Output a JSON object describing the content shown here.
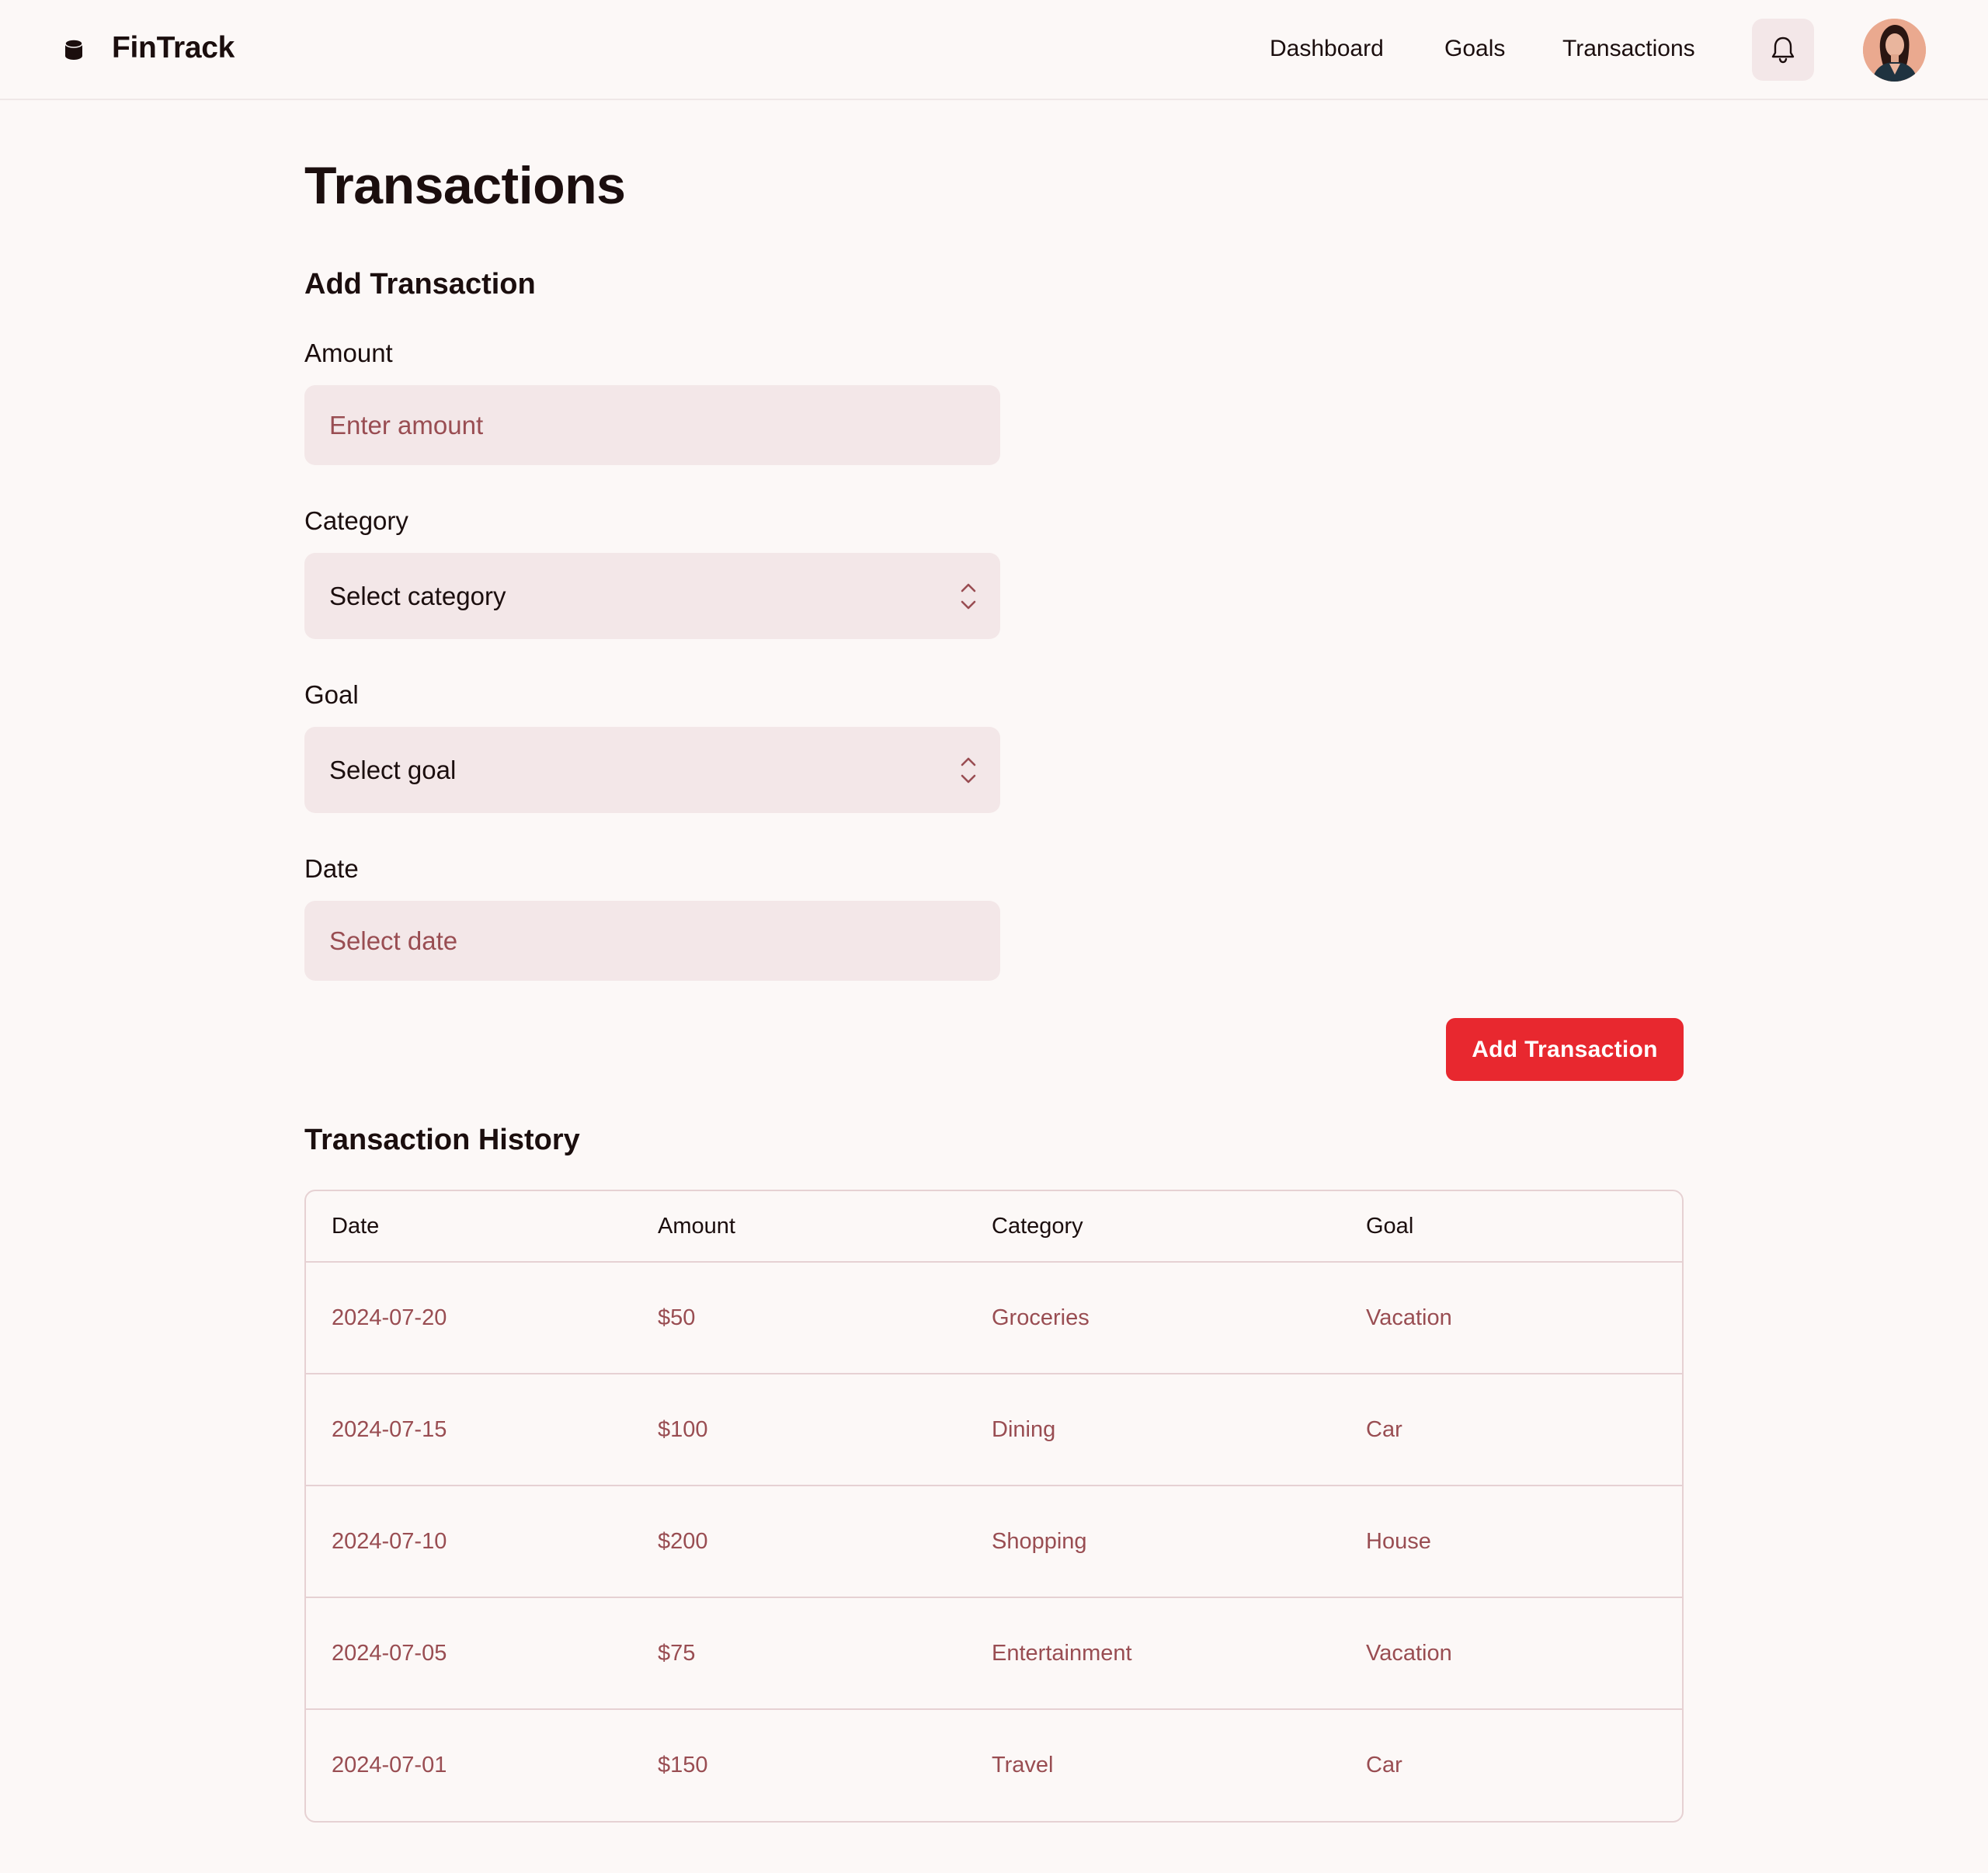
{
  "header": {
    "brand": "FinTrack",
    "nav": [
      {
        "label": "Dashboard"
      },
      {
        "label": "Goals"
      },
      {
        "label": "Transactions"
      }
    ],
    "notification_icon": "bell-icon",
    "avatar": "user-avatar"
  },
  "page": {
    "title": "Transactions"
  },
  "form": {
    "section_title": "Add Transaction",
    "amount": {
      "label": "Amount",
      "placeholder": "Enter amount"
    },
    "category": {
      "label": "Category",
      "value": "Select category"
    },
    "goal": {
      "label": "Goal",
      "value": "Select goal"
    },
    "date": {
      "label": "Date",
      "placeholder": "Select date"
    },
    "submit_label": "Add Transaction"
  },
  "history": {
    "section_title": "Transaction History",
    "columns": [
      "Date",
      "Amount",
      "Category",
      "Goal"
    ],
    "rows": [
      [
        "2024-07-20",
        "$50",
        "Groceries",
        "Vacation"
      ],
      [
        "2024-07-15",
        "$100",
        "Dining",
        "Car"
      ],
      [
        "2024-07-10",
        "$200",
        "Shopping",
        "House"
      ],
      [
        "2024-07-05",
        "$75",
        "Entertainment",
        "Vacation"
      ],
      [
        "2024-07-01",
        "$150",
        "Travel",
        "Car"
      ]
    ]
  },
  "colors": {
    "background": "#fcf8f7",
    "input_bg": "#f3e7e8",
    "accent": "#e8282f",
    "muted_text": "#994d52",
    "border": "#e6d1d3"
  }
}
